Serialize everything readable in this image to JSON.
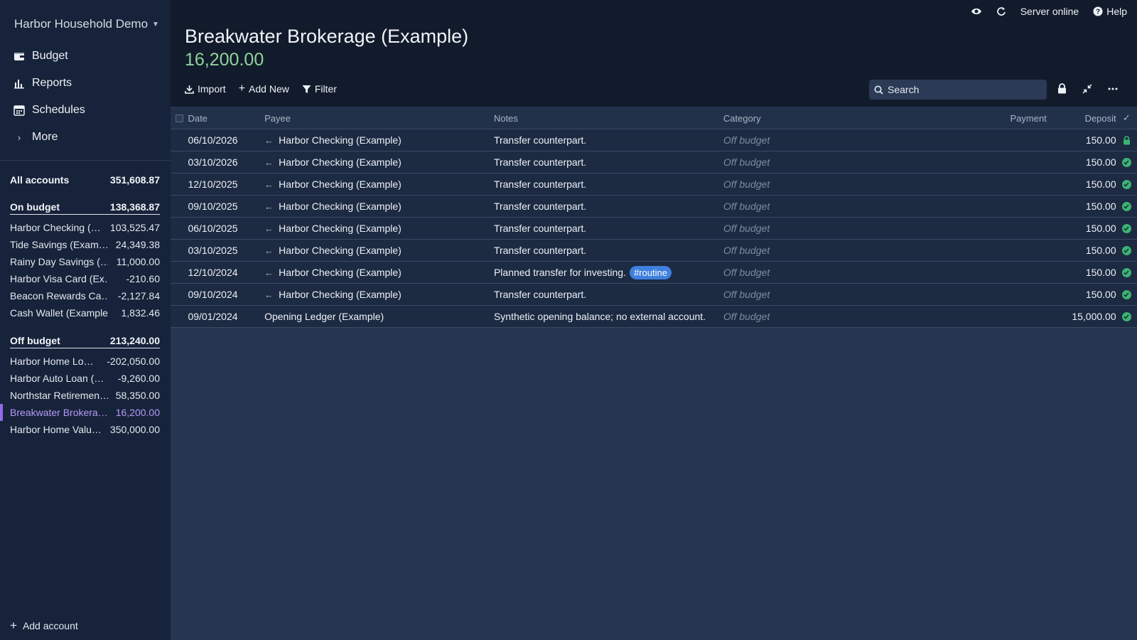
{
  "app": {
    "budget_name": "Harbor Household Demo"
  },
  "nav": {
    "budget": "Budget",
    "reports": "Reports",
    "schedules": "Schedules",
    "more": "More"
  },
  "accounts": {
    "all": {
      "label": "All accounts",
      "balance": "351,608.87"
    },
    "on_budget": {
      "label": "On budget",
      "balance": "138,368.87",
      "items": [
        {
          "name": "Harbor Checking (…",
          "balance": "103,525.47"
        },
        {
          "name": "Tide Savings (Exam…",
          "balance": "24,349.38"
        },
        {
          "name": "Rainy Day Savings (…",
          "balance": "11,000.00"
        },
        {
          "name": "Harbor Visa Card (Ex…",
          "balance": "-210.60"
        },
        {
          "name": "Beacon Rewards Ca…",
          "balance": "-2,127.84"
        },
        {
          "name": "Cash Wallet (Example)",
          "balance": "1,832.46"
        }
      ]
    },
    "off_budget": {
      "label": "Off budget",
      "balance": "213,240.00",
      "items": [
        {
          "name": "Harbor Home Lo…",
          "balance": "-202,050.00"
        },
        {
          "name": "Harbor Auto Loan (…",
          "balance": "-9,260.00"
        },
        {
          "name": "Northstar Retiremen…",
          "balance": "58,350.00"
        },
        {
          "name": "Breakwater Brokera…",
          "balance": "16,200.00"
        },
        {
          "name": "Harbor Home Valu…",
          "balance": "350,000.00"
        }
      ]
    },
    "add_account": "Add account"
  },
  "topbar": {
    "server_status": "Server online",
    "help": "Help"
  },
  "account_view": {
    "title": "Breakwater Brokerage (Example)",
    "balance": "16,200.00",
    "toolbar": {
      "import": "Import",
      "add_new": "Add New",
      "filter": "Filter",
      "search_placeholder": "Search"
    }
  },
  "table": {
    "headers": {
      "date": "Date",
      "payee": "Payee",
      "notes": "Notes",
      "category": "Category",
      "payment": "Payment",
      "deposit": "Deposit",
      "cleared": "✓"
    },
    "rows": [
      {
        "date": "06/10/2026",
        "payee": "Harbor Checking (Example)",
        "notes": "Transfer counterpart.",
        "tag": "",
        "category": "Off budget",
        "payment": "",
        "deposit": "150.00"
      },
      {
        "date": "03/10/2026",
        "payee": "Harbor Checking (Example)",
        "notes": "Transfer counterpart.",
        "tag": "",
        "category": "Off budget",
        "payment": "",
        "deposit": "150.00"
      },
      {
        "date": "12/10/2025",
        "payee": "Harbor Checking (Example)",
        "notes": "Transfer counterpart.",
        "tag": "",
        "category": "Off budget",
        "payment": "",
        "deposit": "150.00"
      },
      {
        "date": "09/10/2025",
        "payee": "Harbor Checking (Example)",
        "notes": "Transfer counterpart.",
        "tag": "",
        "category": "Off budget",
        "payment": "",
        "deposit": "150.00"
      },
      {
        "date": "06/10/2025",
        "payee": "Harbor Checking (Example)",
        "notes": "Transfer counterpart.",
        "tag": "",
        "category": "Off budget",
        "payment": "",
        "deposit": "150.00"
      },
      {
        "date": "03/10/2025",
        "payee": "Harbor Checking (Example)",
        "notes": "Transfer counterpart.",
        "tag": "",
        "category": "Off budget",
        "payment": "",
        "deposit": "150.00"
      },
      {
        "date": "12/10/2024",
        "payee": "Harbor Checking (Example)",
        "notes": "Planned transfer for investing.",
        "tag": "#routine",
        "category": "Off budget",
        "payment": "",
        "deposit": "150.00"
      },
      {
        "date": "09/10/2024",
        "payee": "Harbor Checking (Example)",
        "notes": "Transfer counterpart.",
        "tag": "",
        "category": "Off budget",
        "payment": "",
        "deposit": "150.00"
      },
      {
        "date": "09/01/2024",
        "payee": "Opening Ledger (Example)",
        "notes": "Synthetic opening balance; no external account.",
        "tag": "",
        "category": "Off budget",
        "payment": "",
        "deposit": "15,000.00"
      }
    ]
  },
  "colors": {
    "sidebar_bg": "#17233a",
    "main_bg": "#263650",
    "header_bg": "#121b2b",
    "balance_green": "#8fd39a",
    "active_purple": "#b59af5",
    "cleared_green": "#3cb371",
    "tag_blue": "#3f7fdf"
  }
}
